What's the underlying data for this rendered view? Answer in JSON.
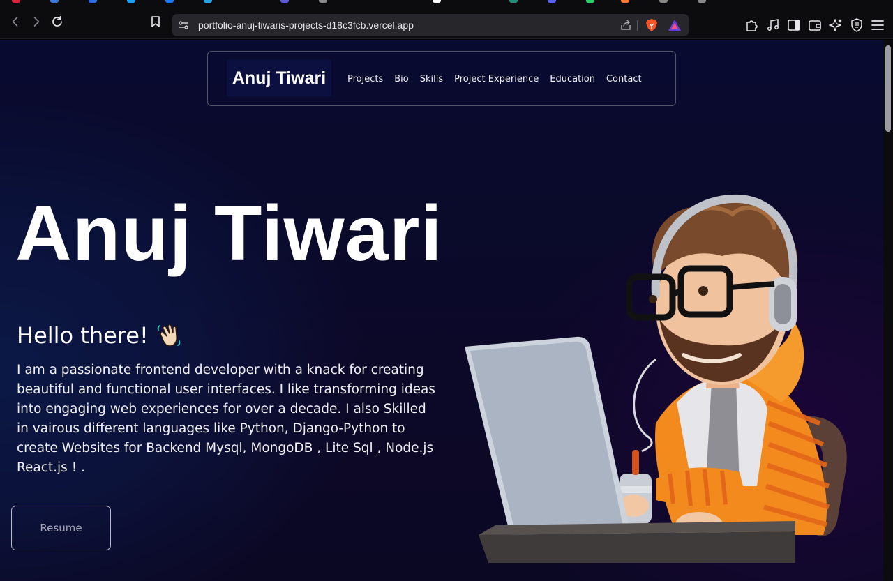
{
  "browser": {
    "url": "portfolio-anuj-tiwaris-projects-d18c3fcb.vercel.app",
    "tab_favicon_colors": [
      "#e0223b",
      "#3a7bd5",
      "#2d6cdf",
      "#1da1f2",
      "#1877f2",
      "#29a3e6",
      "#5b5bd6",
      "#888888",
      "#ffffff",
      "#ffffff",
      "#1f8f7a",
      "#5865f2",
      "#25d366",
      "#ff7a2f",
      "#888888",
      "#888888"
    ]
  },
  "navbar": {
    "brand": "Anuj Tiwari",
    "links": [
      "Projects",
      "Bio",
      "Skills",
      "Project Experience",
      "Education",
      "Contact"
    ]
  },
  "hero": {
    "title": "Anuj Tiwari",
    "greeting": "Hello there!",
    "greeting_emoji": "waving-hand-icon",
    "bio": "I am a passionate frontend developer with a knack for creating beautiful and functional user interfaces. I like transforming ideas into engaging web experiences for over a decade. I also Skilled in vairous different languages like Python, Django-Python to create Websites for Backend Mysql, MongoDB , Lite Sql , Node.js React.js ! .",
    "resume_label": "Resume"
  },
  "illustration": "developer-avatar-with-laptop",
  "colors": {
    "background": "#0a0a2b",
    "brand_bg": "#0c1040",
    "accent_hoodie": "#f28a1e"
  }
}
